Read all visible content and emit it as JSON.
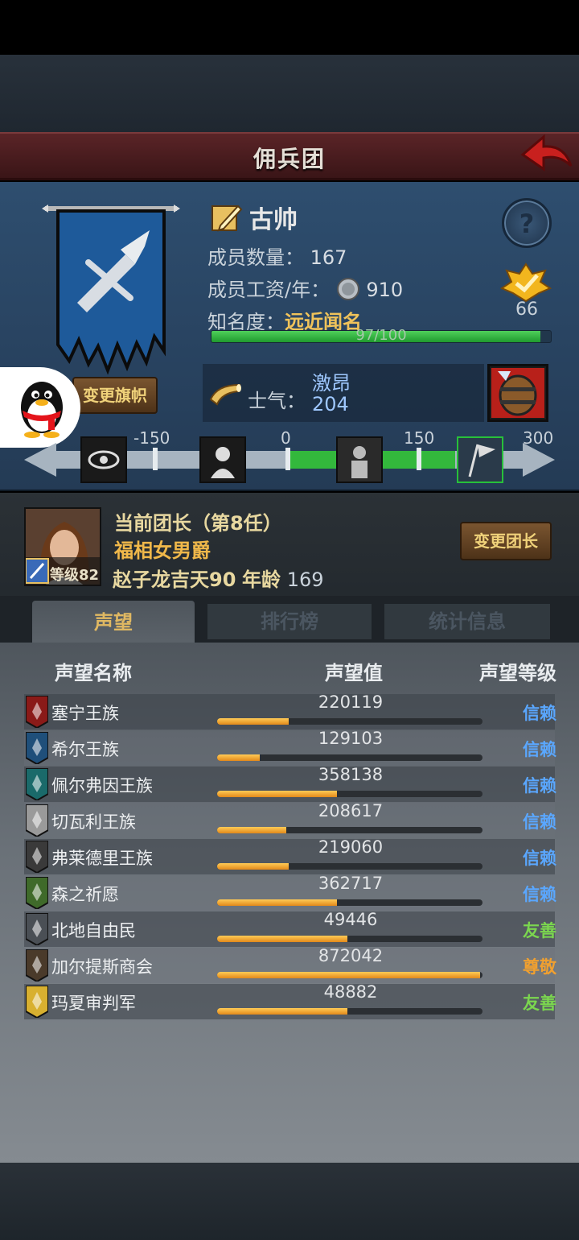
{
  "header": {
    "title": "佣兵团"
  },
  "company": {
    "name": "古帅",
    "members_label": "成员数量：",
    "members_value": "167",
    "wage_label": "成员工资/年：",
    "wage_value": "910",
    "fame_label": "知名度：",
    "fame_value": "远近闻名",
    "fame_progress": "97/100",
    "fame_fraction": 0.97,
    "medal_count": "66",
    "change_flag_label": "变更旗帜"
  },
  "morale": {
    "label": "士气：",
    "state": "激昂",
    "value": "204",
    "ticks": [
      "-150",
      "0",
      "150",
      "300"
    ],
    "active_segment": "150-300"
  },
  "leader": {
    "title": "当前团长（第8任）",
    "name": "福相女男爵",
    "level_label": "等级82",
    "info_name": "赵子龙吉天90",
    "age_label": "年龄",
    "age_value": "169",
    "change_button": "变更团长"
  },
  "tabs": [
    {
      "label": "声望",
      "active": true
    },
    {
      "label": "排行榜",
      "active": false
    },
    {
      "label": "统计信息",
      "active": false
    }
  ],
  "columns": {
    "name": "声望名称",
    "value": "声望值",
    "level": "声望等级"
  },
  "factions": [
    {
      "name": "塞宁王族",
      "value": "220119",
      "fill": 0.27,
      "level": "信赖",
      "level_color": "#5aa7ff",
      "icon_color": "#8a1a18"
    },
    {
      "name": "希尔王族",
      "value": "129103",
      "fill": 0.16,
      "level": "信赖",
      "level_color": "#5aa7ff",
      "icon_color": "#1f4f7a"
    },
    {
      "name": "佩尔弗因王族",
      "value": "358138",
      "fill": 0.45,
      "level": "信赖",
      "level_color": "#5aa7ff",
      "icon_color": "#1a6a6a"
    },
    {
      "name": "切瓦利王族",
      "value": "208617",
      "fill": 0.26,
      "level": "信赖",
      "level_color": "#5aa7ff",
      "icon_color": "#9a9a9a"
    },
    {
      "name": "弗莱德里王族",
      "value": "219060",
      "fill": 0.27,
      "level": "信赖",
      "level_color": "#5aa7ff",
      "icon_color": "#3a3a3a"
    },
    {
      "name": "森之祈愿",
      "value": "362717",
      "fill": 0.45,
      "level": "信赖",
      "level_color": "#5aa7ff",
      "icon_color": "#3f6a2a"
    },
    {
      "name": "北地自由民",
      "value": "49446",
      "fill": 0.49,
      "level": "友善",
      "level_color": "#7bd64f",
      "icon_color": "#4a4f55"
    },
    {
      "name": "加尔提斯商会",
      "value": "872042",
      "fill": 0.99,
      "level": "尊敬",
      "level_color": "#f0a030",
      "icon_color": "#4a3a2a"
    },
    {
      "name": "玛夏审判军",
      "value": "48882",
      "fill": 0.49,
      "level": "友善",
      "level_color": "#7bd64f",
      "icon_color": "#d8b030"
    }
  ]
}
